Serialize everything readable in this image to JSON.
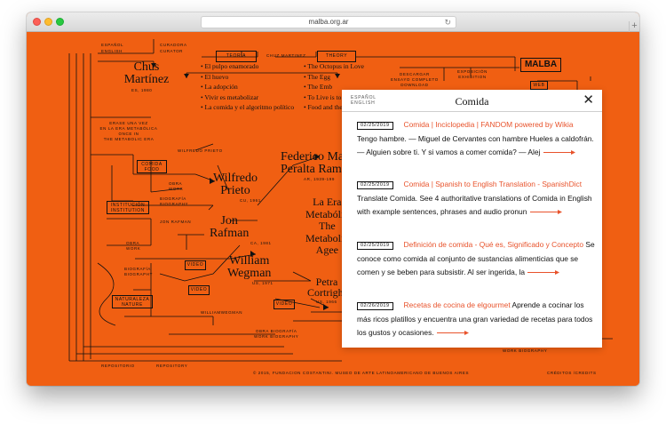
{
  "browser": {
    "url": "malba.org.ar",
    "reload_glyph": "↻",
    "new_tab_glyph": "+"
  },
  "colors": {
    "page_background": "#f05f12",
    "ink": "#111111",
    "link": "#e8532c"
  },
  "diagram": {
    "lang_es": "ESPAÑOL",
    "lang_en": "ENGLISH",
    "curadora": "CURADORA",
    "curator": "CURATOR",
    "teoria": "TEORÍA",
    "chuz": "CHUZ MARTINEZ",
    "theory": "THEORY",
    "curator_name_1": "Chus",
    "curator_name_2": "Martínez",
    "curator_year": "ES, 1980",
    "es_items": [
      "• El pulpo enamorado",
      "• El huevo",
      "• La adopción",
      "• Vivir es metabolizar",
      "• La comida y el algoritmo político"
    ],
    "en_items": [
      "• The Octopus in Love",
      "• The Egg",
      "• The Emb",
      "• To Live is to M",
      "• Food and the Polit"
    ],
    "descargar_1": "DESCARGAR",
    "descargar_2": "ENSAYO COMPLETO",
    "descargar_3": "DOWNLOAD",
    "exposicion_1": "EXPOSICIÓN",
    "exposicion_2": "EXHIBITION",
    "logo": "MALBA",
    "web": "WEB",
    "erase_1": "ERASE UNA VEZ",
    "erase_2": "EN LA ERA METABÓLICA",
    "erase_3": "ONCE IN",
    "erase_4": "THE METABOLIC ERA",
    "wilfredo_small": "WILFREDO PRIETO",
    "comida_food_1": "COMIDA",
    "comida_food_2": "FOOD",
    "obra_work_1": "OBRA",
    "obra_work_2": "WORK",
    "biografia_1": "BIOGRAFÍA",
    "biografia_2": "BIOGRAPHY",
    "institucion_1": "INSTITUCIÓN",
    "institucion_2": "INSTITUTION",
    "jon_small": "JON RAFMAN",
    "wilfredo_1": "Wilfredo",
    "wilfredo_2": "Prieto",
    "wilfredo_year": "CU, 1961",
    "jon_1": "Jon",
    "jon_2": "Rafman",
    "jon_year": "CA, 1981",
    "william_1": "William",
    "william_2": "Wegman",
    "william_year": "US, 1971",
    "federico_1": "Federico Man",
    "federico_2": "Peralta Ramo",
    "federico_year": "AR, 1939-199",
    "era_1": "La Era",
    "era_2": "Metabólic",
    "era_3": "The",
    "era_4": "Metabolic",
    "era_5": "Agee",
    "petra_1": "Petra",
    "petra_2": "Cortright",
    "petra_year": "US, 1966",
    "obra_work_b1": "OBRA",
    "obra_work_b2": "WORK",
    "biografia_b1": "BIOGRAFÍA",
    "biografia_b2": "BIOGRAPHY",
    "video_1": "VIDEO",
    "video_2": "VIDEO",
    "video_3": "VIDEO",
    "williamwegman_small": "WILLIAMWEGMAN",
    "naturaleza_1": "NATURALEZA",
    "naturaleza_2": "NATURE",
    "obra_bio_1": "OBRA BIOGRAFÍA",
    "obra_bio_2": "WORK BIOGRAPHY",
    "work_bio_right": "WORK BIOGRAPHY",
    "repositorio": "REPOSITORIO",
    "repository": "REPOSITORY",
    "footer": "© 2015, FUNDACION COSTANTINI. MUSEO DE ARTE LATINOAMERICANO DE BUENOS AIRES",
    "creditos": "CRÉDITOS /CREDITS"
  },
  "search_panel": {
    "lang_es": "ESPAÑOL",
    "lang_en": "ENGLISH",
    "title": "Comida",
    "close_glyph": "✕",
    "results": [
      {
        "date": "02/25/2019",
        "link": "Comida | Inciclopedia | FANDOM powered by Wikia",
        "snippet": "Tengo hambre. — Miguel de Cervantes con hambre Hueles a caldofrán. — Alguien sobre ti. Y si vamos a comer comida? — Alej"
      },
      {
        "date": "02/25/2019",
        "link": "Comida | Spanish to English Translation - SpanishDict",
        "snippet": "Translate Comida. See 4 authoritative translations of Comida in English with example sentences, phrases and audio pronun"
      },
      {
        "date": "02/25/2019",
        "link": "Definición de comida - Qué es, Significado y Concepto",
        "snippet": "Se conoce como comida al conjunto de sustancias alimenticias que se comen y se beben para subsistir. Al ser ingerida, la"
      },
      {
        "date": "02/26/2019",
        "link": "Recetas de cocina de elgourmet",
        "snippet": "Aprende a cocinar los más ricos platillos y encuentra una gran variedad de recetas para todos los gustos y ocasiones."
      }
    ]
  }
}
